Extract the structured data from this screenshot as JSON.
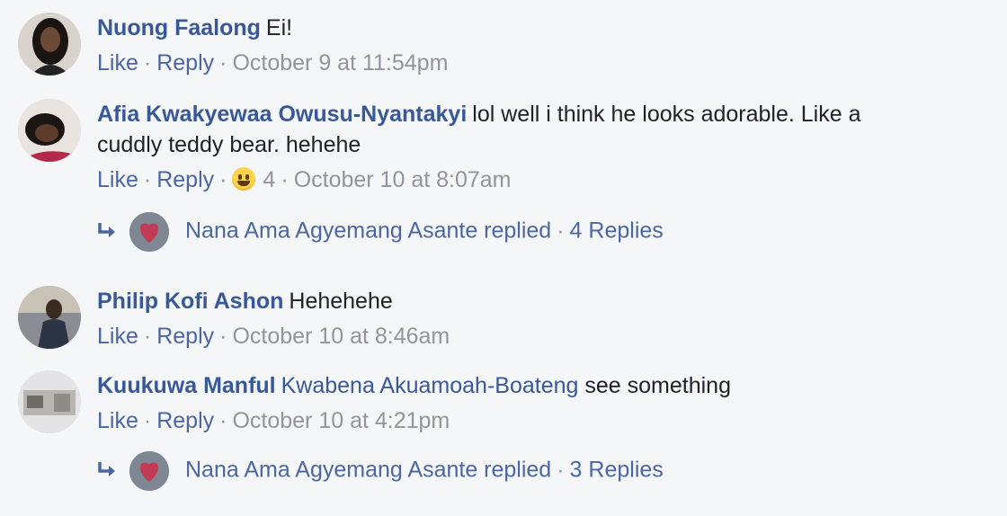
{
  "comments": [
    {
      "author": "Nuong Faalong",
      "text": "Ei!",
      "like": "Like",
      "reply": "Reply",
      "time": "October 9 at 11:54pm"
    },
    {
      "author": "Afia Kwakyewaa Owusu-Nyantakyi",
      "text": "lol well i think he looks adorable. Like a",
      "text2": "cuddly teddy bear. hehehe",
      "like": "Like",
      "reply": "Reply",
      "reaction": "haha-emoji",
      "reaction_count": "4",
      "time": "October 10 at 8:07am"
    },
    {
      "author": "Philip Kofi Ashon",
      "text": "Hehehehe",
      "like": "Like",
      "reply": "Reply",
      "time": "October 10 at 8:46am"
    },
    {
      "author": "Kuukuwa Manful",
      "mention": "Kwabena Akuamoah-Boateng",
      "text": "see something",
      "like": "Like",
      "reply": "Reply",
      "time": "October 10 at 4:21pm"
    }
  ],
  "reply_threads": [
    {
      "summary": "Nana Ama Agyemang Asante replied",
      "count": "4 Replies"
    },
    {
      "summary": "Nana Ama Agyemang Asante replied",
      "count": "3 Replies"
    }
  ],
  "colors": {
    "author": "#385898",
    "meta": "#90949c",
    "background": "#f5f6f8"
  }
}
